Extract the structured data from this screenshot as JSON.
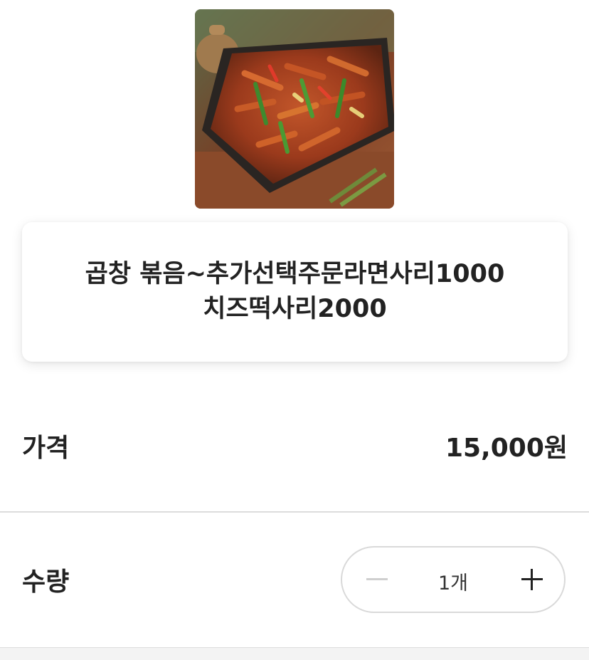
{
  "menu": {
    "name_line1": "곱창 볶음~추가선택주문라면사리1000",
    "name_line2": "치즈떡사리2000"
  },
  "price": {
    "label": "가격",
    "value": "15,000원"
  },
  "quantity": {
    "label": "수량",
    "value": "1개",
    "decrease_icon": "minus-icon",
    "increase_icon": "plus-icon"
  },
  "colors": {
    "text": "#222222",
    "divider": "#dcdcdc",
    "stepper_border": "#d9d9d9",
    "minus_disabled": "#cfcfcf"
  }
}
